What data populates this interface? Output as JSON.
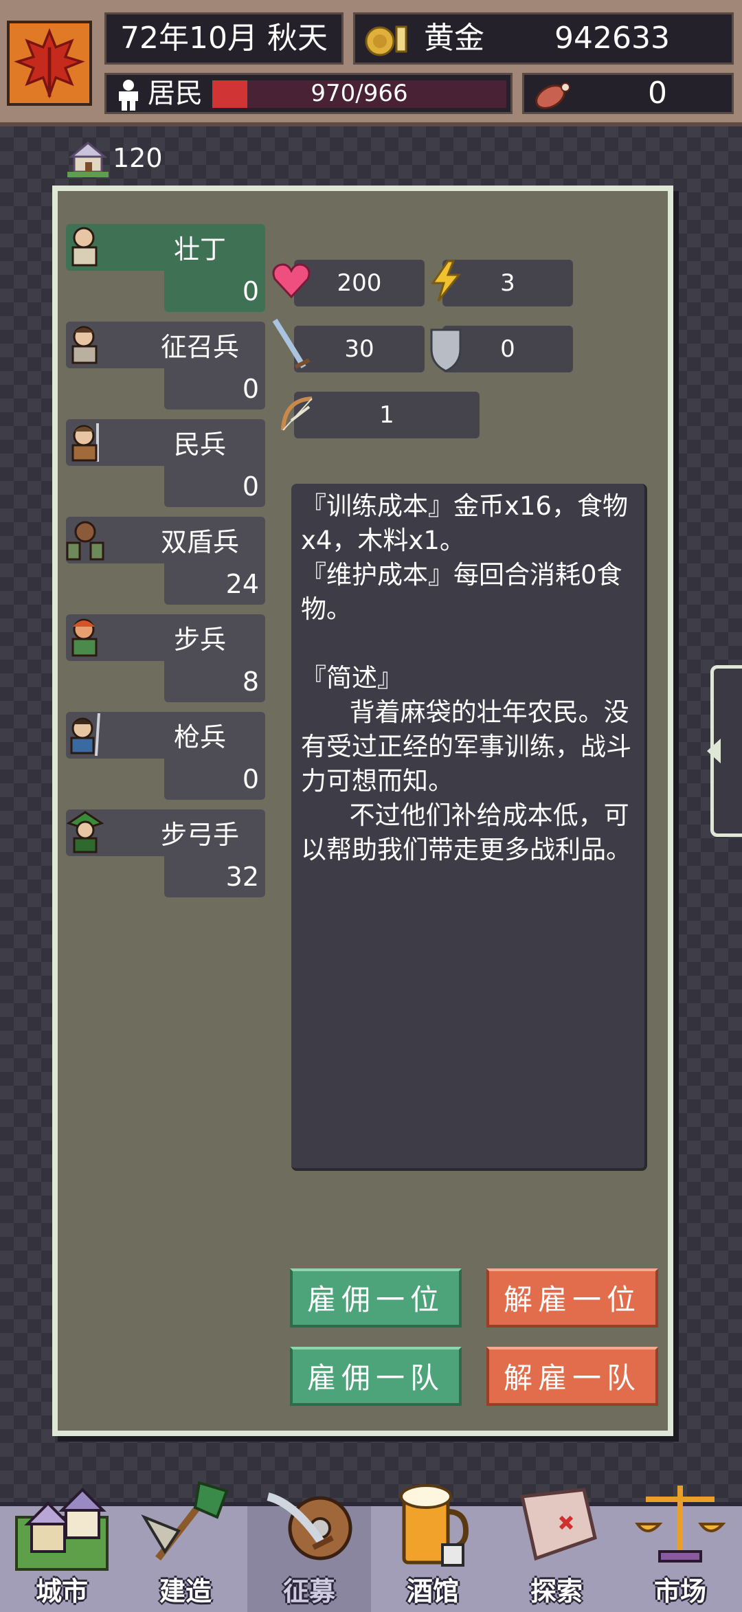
{
  "topbar": {
    "date": "72年10月 秋天",
    "gold_label": "黄金",
    "gold_value": "942633",
    "residents_label": "居民",
    "residents_value": "970/966",
    "residents_fill": 0.12,
    "meat_value": "0"
  },
  "house_count": "120",
  "units": [
    {
      "name": "壮丁",
      "count": "0"
    },
    {
      "name": "征召兵",
      "count": "0"
    },
    {
      "name": "民兵",
      "count": "0"
    },
    {
      "name": "双盾兵",
      "count": "24"
    },
    {
      "name": "步兵",
      "count": "8"
    },
    {
      "name": "枪兵",
      "count": "0"
    },
    {
      "name": "步弓手",
      "count": "32"
    }
  ],
  "stats": {
    "hp": "200",
    "speed": "3",
    "attack": "30",
    "defense": "0",
    "range": "1"
  },
  "description": "『训练成本』金币x16，食物x4，木料x1。\n『维护成本』每回合消耗0食物。\n\n『简述』\n      背着麻袋的壮年农民。没有受过正经的军事训练，战斗力可想而知。\n      不过他们补给成本低，可以帮助我们带走更多战利品。",
  "buttons": {
    "hire_one": "雇佣一位",
    "fire_one": "解雇一位",
    "hire_team": "雇佣一队",
    "fire_team": "解雇一队"
  },
  "nav": [
    "城市",
    "建造",
    "征募",
    "酒馆",
    "探索",
    "市场"
  ],
  "colors": {
    "selected_unit": "#3f7255",
    "hire_button": "#4ea47a",
    "fire_button": "#e26d4c"
  }
}
